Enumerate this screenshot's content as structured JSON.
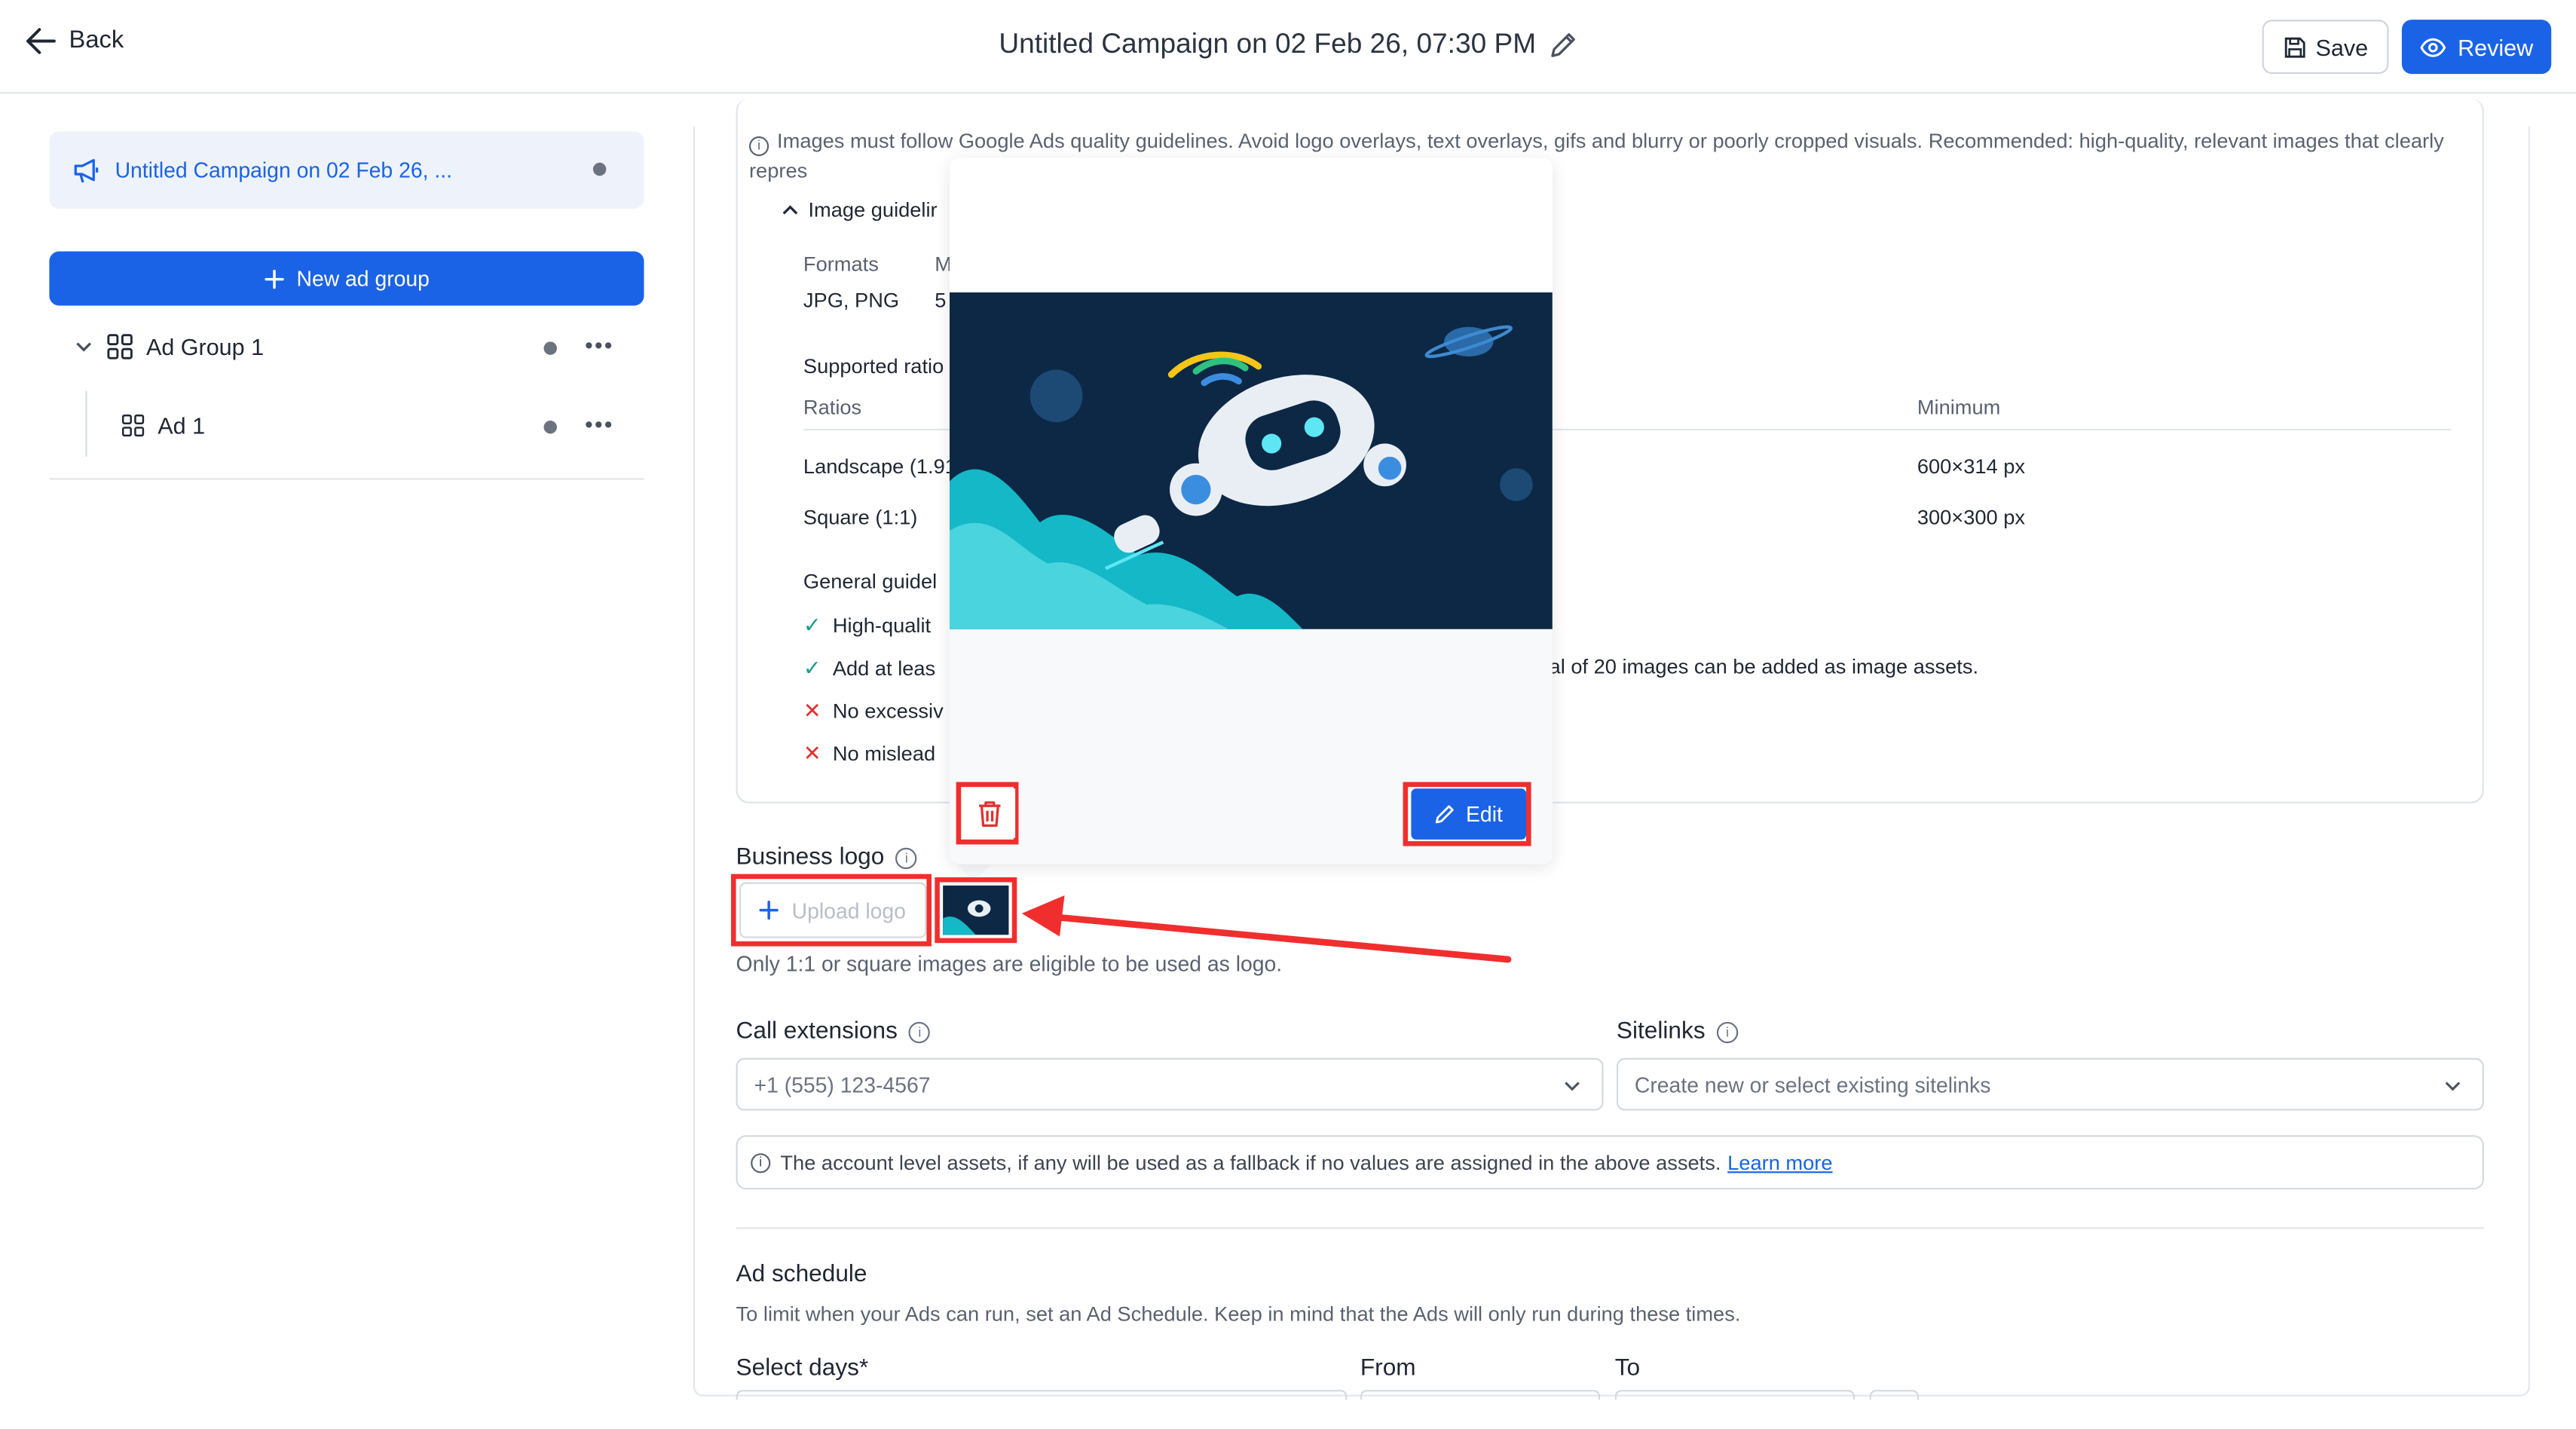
{
  "header": {
    "back_label": "Back",
    "title": "Untitled Campaign on 02 Feb 26, 07:30 PM",
    "save_label": "Save",
    "review_label": "Review"
  },
  "sidebar": {
    "campaign_label": "Untitled Campaign on 02 Feb 26, ...",
    "new_group_label": "New ad group",
    "ad_group_label": "Ad Group 1",
    "ad_label": "Ad 1"
  },
  "guidelines": {
    "info_text": "Images must follow Google Ads quality guidelines. Avoid logo overlays, text overlays, gifs and blurry or poorly cropped visuals. Recommended: high-quality, relevant images that clearly repres",
    "toggle_label": "Image guidelir",
    "formats_header": "Formats",
    "formats_header_2": "M",
    "formats_value": "JPG, PNG",
    "formats_value_2": "5",
    "supported_ratios": "Supported ratio",
    "ratios_header": "Ratios",
    "minimum_header": "Minimum",
    "landscape_label": "Landscape (1.91",
    "landscape_min": "600×314 px",
    "square_label": "Square (1:1)",
    "square_min": "300×300 px",
    "general_title": "General guidel",
    "item1": "High-qualit",
    "item2": "Add at leas",
    "item2_tail": "al of 20 images can be added as image assets.",
    "item3": "No excessiv",
    "item4": "No mislead"
  },
  "popup": {
    "edit_label": "Edit"
  },
  "business_logo": {
    "label": "Business logo",
    "upload_label": "Upload logo",
    "hint": "Only 1:1 or square images are eligible to be used as logo."
  },
  "call_extensions": {
    "label": "Call extensions",
    "placeholder": "+1 (555) 123-4567"
  },
  "sitelinks": {
    "label": "Sitelinks",
    "placeholder": "Create new or select existing sitelinks"
  },
  "notice": {
    "text": "The account level assets, if any will be used as a fallback if no values are assigned in the above assets.",
    "link": "Learn more"
  },
  "schedule": {
    "title": "Ad schedule",
    "description": "To limit when your Ads can run, set an Ad Schedule. Keep in mind that the Ads will only run during these times.",
    "days_label": "Select days*",
    "from_label": "From",
    "to_label": "To"
  },
  "colors": {
    "primary": "#1a63e6",
    "annotation": "#f02e2e",
    "check": "#1a9c8a",
    "cross": "#e03131"
  }
}
